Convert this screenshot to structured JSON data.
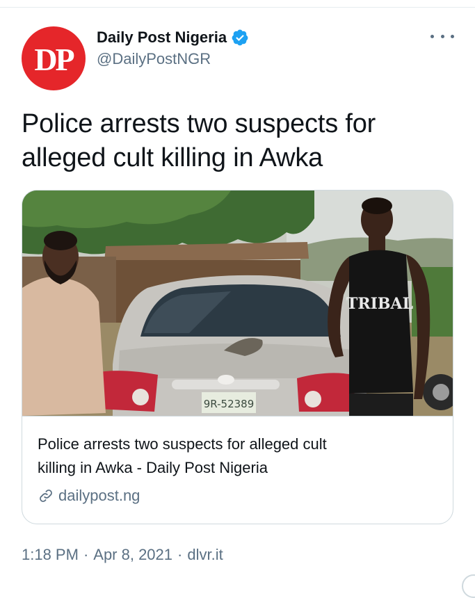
{
  "colors": {
    "brand_red": "#e5262a",
    "verified_blue": "#1da1f2",
    "secondary_text": "#5b7083"
  },
  "tweet": {
    "avatar_text": "DP",
    "display_name": "Daily Post Nigeria",
    "handle": "@DailyPostNGR",
    "verified_icon": "verified-badge-icon",
    "more_icon": "more-options-icon",
    "text_line1": "Police arrests two suspects for",
    "text_line2": "alleged cult killing in Awka"
  },
  "card": {
    "image_desc": "photo",
    "plate_text": "9R-52389",
    "shirt_text": "TRIBAL",
    "title_line1": "Police arrests two suspects for alleged cult",
    "title_line2": "killing in Awka - Daily Post Nigeria",
    "domain": "dailypost.ng",
    "link_icon": "link-icon"
  },
  "meta": {
    "time": "1:18 PM",
    "date": "Apr 8, 2021",
    "separator": "·",
    "source": "dlvr.it"
  }
}
